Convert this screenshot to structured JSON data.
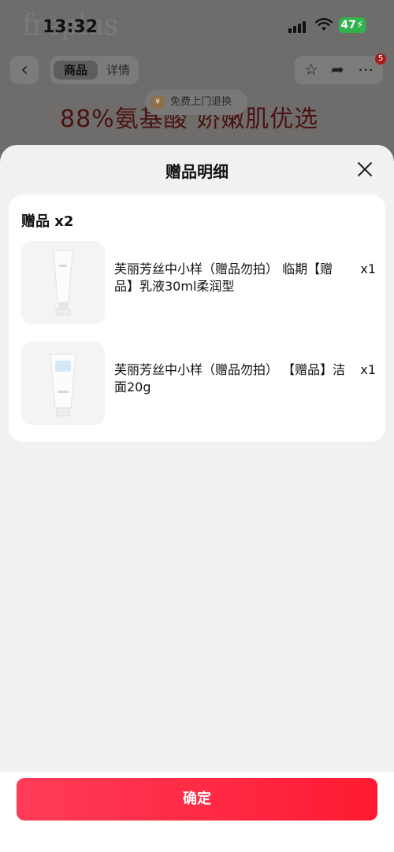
{
  "status_bar": {
    "time": "13:32",
    "battery": "47"
  },
  "background": {
    "logo_text": "freplus",
    "tabs": [
      "商品",
      "详情"
    ],
    "return_label": "免费上门退换",
    "headline": "88%氨基酸   娇嫩肌优选",
    "badge_count": "5"
  },
  "sheet": {
    "title": "赠品明细",
    "gift_heading": "赠品 x2",
    "items": [
      {
        "name": "芙丽芳丝中小样（赠品勿拍） 临期【赠品】乳液30ml柔润型",
        "qty": "x1",
        "thumb_icon": "lotion-tube-icon"
      },
      {
        "name": "芙丽芳丝中小样（赠品勿拍） 【赠品】洁面20g",
        "qty": "x1",
        "thumb_icon": "cleanser-tube-icon"
      }
    ]
  },
  "footer": {
    "confirm_label": "确定"
  },
  "colors": {
    "accent_start": "#ff3c58",
    "accent_end": "#ff1a32",
    "sheet_bg": "#f1f1f4",
    "overlay": "#6f6d6b"
  }
}
